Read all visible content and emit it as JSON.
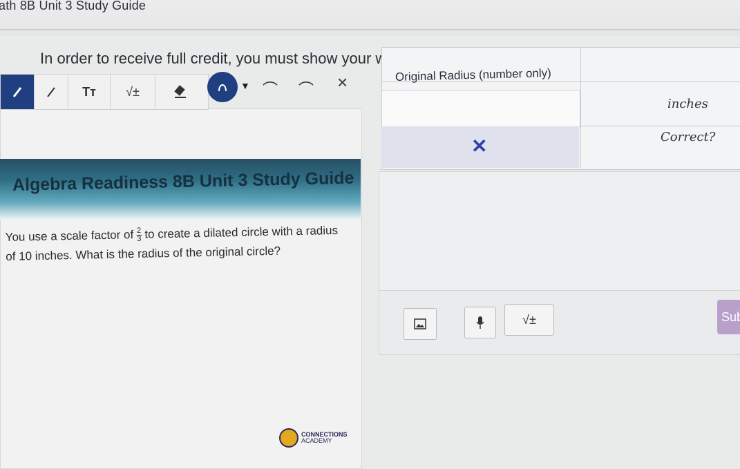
{
  "header": {
    "page_title": "ath 8B Unit 3 Study Guide",
    "instructions": "In order to receive full credit, you must show your work on the slide and explain your answer."
  },
  "toolbar": {
    "text_tool": "Tт",
    "math_tool": "√±"
  },
  "slide": {
    "title": "Algebra Readiness 8B Unit 3 Study Guide",
    "question_part1": "You use a scale factor of",
    "fraction_num": "2",
    "fraction_den": "3",
    "question_part2": "to create a dilated circle with a radius of 10 inches.  What is the radius of the original circle?",
    "logo_line1": "CONNECTIONS",
    "logo_line2": "ACADEMY"
  },
  "answer_table": {
    "header": "Original Radius (number only)",
    "unit": "inches",
    "correct_label": "Correct?",
    "result_mark": "✕"
  },
  "answer_toolbar": {
    "math_label": "√±",
    "submit_label": "Sub"
  },
  "colors": {
    "active_tool": "#1f3f80",
    "banner": "#2f6f86",
    "submit": "#b9a0cb",
    "x_mark": "#2f3fb0"
  }
}
